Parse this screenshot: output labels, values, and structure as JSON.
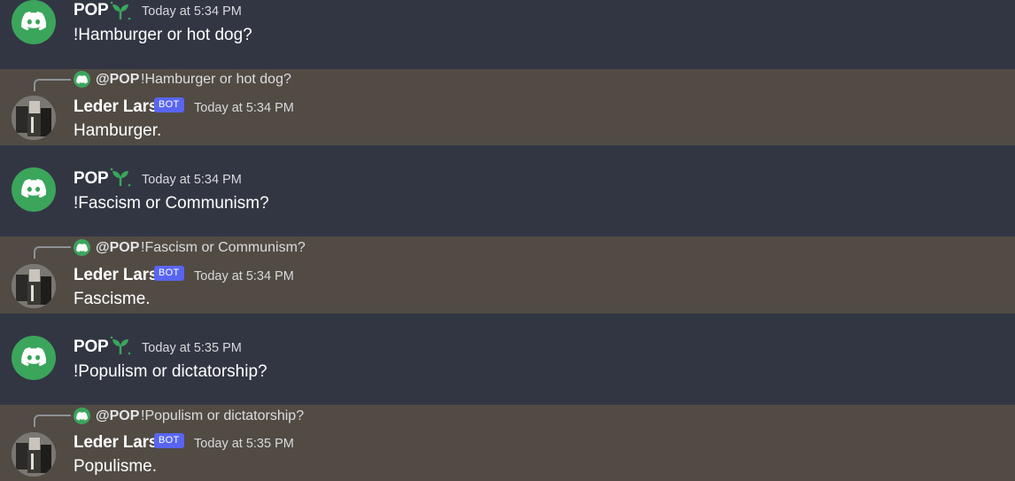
{
  "messages": [
    {
      "type": "user",
      "author": "POP",
      "time": "Today at 5:34 PM",
      "content": "!Hamburger or hot dog?",
      "avatar_icon": "discord-logo-icon",
      "role_icon": "sprout-icon"
    },
    {
      "type": "bot",
      "author": "Leder Lars",
      "badge": "BOT",
      "time": "Today at 5:34 PM",
      "content": "Hamburger.",
      "reply": {
        "author": "@POP",
        "text": "!Hamburger or hot dog?"
      }
    },
    {
      "type": "user",
      "author": "POP",
      "time": "Today at 5:34 PM",
      "content": "!Fascism or Communism?",
      "avatar_icon": "discord-logo-icon",
      "role_icon": "sprout-icon"
    },
    {
      "type": "bot",
      "author": "Leder Lars",
      "badge": "BOT",
      "time": "Today at 5:34 PM",
      "content": "Fascisme.",
      "reply": {
        "author": "@POP",
        "text": "!Fascism or Communism?"
      }
    },
    {
      "type": "user",
      "author": "POP",
      "time": "Today at 5:35 PM",
      "content": "!Populism or dictatorship?",
      "avatar_icon": "discord-logo-icon",
      "role_icon": "sprout-icon"
    },
    {
      "type": "bot",
      "author": "Leder Lars",
      "badge": "BOT",
      "time": "Today at 5:35 PM",
      "content": "Populisme.",
      "reply": {
        "author": "@POP",
        "text": "!Populism or dictatorship?"
      }
    }
  ],
  "colors": {
    "user_row_bg": "#323643",
    "bot_row_bg": "#514b44",
    "discord_green": "#3ba55c",
    "bot_badge": "#5865f2"
  }
}
